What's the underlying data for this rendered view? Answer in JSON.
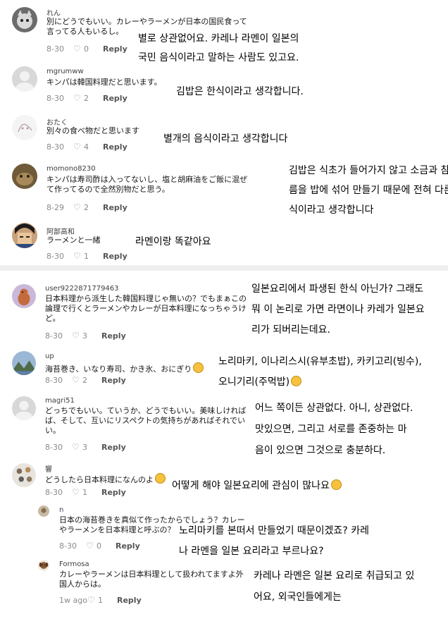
{
  "comments": [
    {
      "username": "れん",
      "jp": [
        "別にどうでもいい。カレーやラーメンが日本の国民食って",
        "言ってる人もいるし。"
      ],
      "date": "8-30",
      "likes": "0",
      "reply": "Reply",
      "kr": [
        "별로 상관없어요. 카레나 라멘이 일본의",
        "국민 음식이라고 말하는 사람도 있고요."
      ],
      "avatar": "cat-photo-avatar"
    },
    {
      "username": "mgrumww",
      "jp": [
        "キンパは韓国料理だと思います。"
      ],
      "date": "8-30",
      "likes": "2",
      "reply": "Reply",
      "kr": [
        "김밥은 한식이라고 생각합니다."
      ],
      "avatar": "default-avatar"
    },
    {
      "username": "おたく",
      "jp": [
        "別々の食べ物だと思います"
      ],
      "date": "8-30",
      "likes": "4",
      "reply": "Reply",
      "kr": [
        "별개의 음식이라고 생각합니다"
      ],
      "avatar": "sketch-avatar"
    },
    {
      "username": "momono8230",
      "jp": [
        "キンパは寿司酢は入ってないし、塩と胡麻油をご飯に混ぜ",
        "て作ってるので全然別物だと思う。"
      ],
      "date": "8-29",
      "likes": "2",
      "reply": "Reply",
      "kr": [
        "김밥은 식초가 들어가지 않고 소금과 참기",
        "름을 밥에 섞어 만들기 때문에 전혀 다른 음",
        "식이라고 생각합니다"
      ],
      "avatar": "animal-photo-avatar"
    },
    {
      "username": "阿部高和",
      "jp": [
        "ラーメンと一緒"
      ],
      "date": "8-30",
      "likes": "1",
      "reply": "Reply",
      "kr": [
        "라멘이랑 똑같아요"
      ],
      "avatar": "anime-man-avatar"
    },
    {
      "username": "user9222871779463",
      "jp": [
        "日本料理から派生した韓国料理じゃ無いの？でもまぁこの",
        "論理で行くとラーメンやカレーが日本料理になっちゃうけ",
        "ど。"
      ],
      "date": "8-30",
      "likes": "3",
      "reply": "Reply",
      "kr": [
        "일본요리에서 파생된 한식 아닌가? 그래도",
        "뭐 이 논리로 가면 라면이나 카레가 일본요",
        "리가 되버리는데요."
      ],
      "avatar": "bird-avatar"
    },
    {
      "username": "up",
      "jp": [
        "海苔巻き、いなり寿司、かき氷、おにぎり"
      ],
      "date": "8-30",
      "likes": "2",
      "reply": "Reply",
      "kr": [
        "노리마키, 이나리스시(유부초밥), 카키고리(빙수),",
        "오니기리(주먹밥)"
      ],
      "avatar": "landscape-avatar",
      "emoji": true
    },
    {
      "username": "magri51",
      "jp": [
        "どっちでもいい。ていうか、どうでもいい。美味しければ",
        "ば、そして、互いにリスペクトの気持ちがあればそれでい",
        "い。"
      ],
      "date": "8-30",
      "likes": "3",
      "reply": "Reply",
      "kr": [
        "어느 쪽이든 상관없다. 아니, 상관없다.",
        "맛있으면, 그리고 서로를 존중하는 마",
        "음이 있으면 그것으로 충분하다."
      ],
      "avatar": "default-avatar"
    },
    {
      "username": "響",
      "jp": [
        "どうしたら日本料理になんのよ"
      ],
      "date": "8-30",
      "likes": "1",
      "reply": "Reply",
      "kr": [
        "어떻게 해야 일본요리에 관심이 많나요"
      ],
      "avatar": "dots-avatar",
      "emoji": true
    },
    {
      "username": "n",
      "jp": [
        "日本の海苔巻きを真似て作ったからでしょう？カレー",
        "やラーメンを日本料理と呼ぶの？"
      ],
      "date": "8-30",
      "likes": "0",
      "reply": "Reply",
      "kr": [
        "노리마키를 본떠서 만들었기 때문이겠죠? 카레",
        "나 라멘을 일본 요리라고 부르나요?"
      ],
      "avatar": "small-photo-avatar"
    },
    {
      "username": "Formosa",
      "jp": [
        "カレーやラーメンは日本料理として扱われてますよ外",
        "国人からは。"
      ],
      "date": "1w ago",
      "likes": "1",
      "reply": "Reply",
      "kr": [
        "카레나 라멘은 일본 요리로 취급되고 있",
        "어요, 외국인들에게는"
      ],
      "avatar": "dog-avatar"
    }
  ]
}
